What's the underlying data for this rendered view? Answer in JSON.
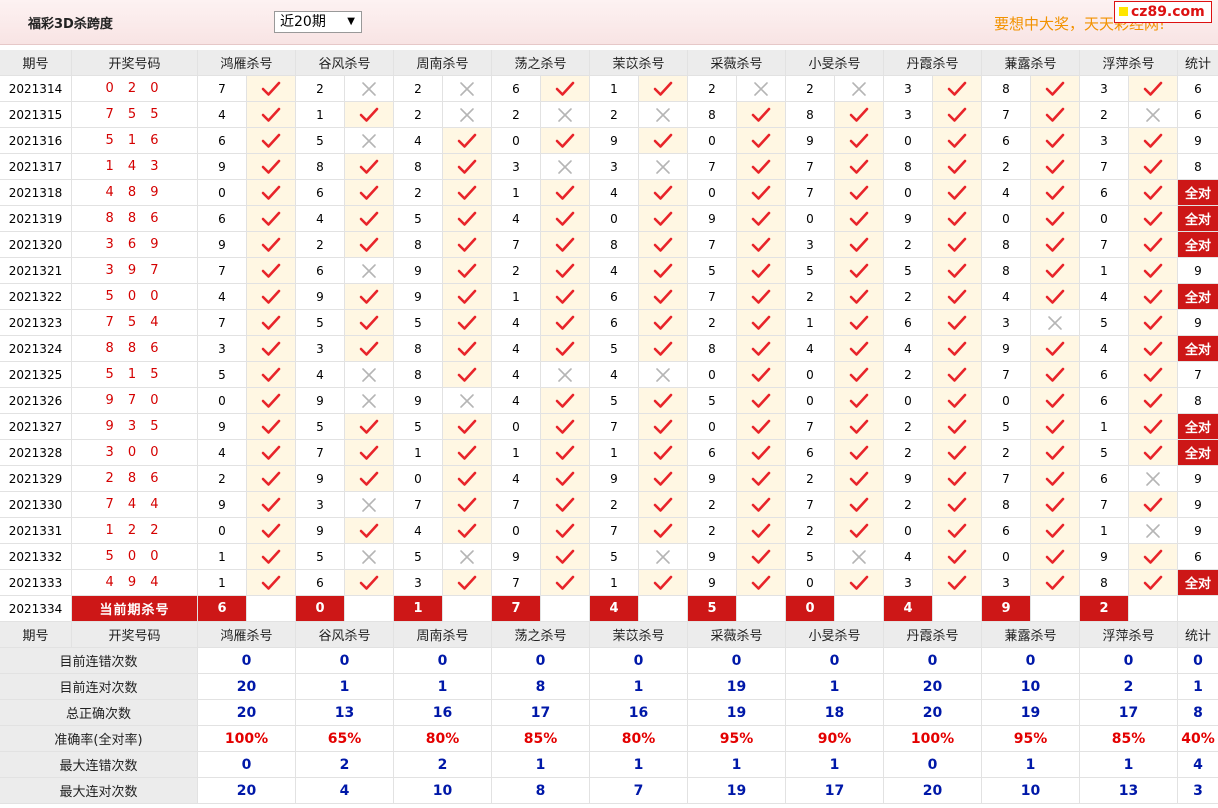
{
  "header": {
    "title": "福彩3D杀跨度",
    "period_option": "近20期",
    "slogan": "要想中大奖，天天彩经网!",
    "site_badge": "cz89.com"
  },
  "columns": {
    "period": "期号",
    "draw": "开奖号码",
    "experts": [
      "鸿雁杀号",
      "谷风杀号",
      "周南杀号",
      "荡之杀号",
      "茉苡杀号",
      "采薇杀号",
      "小旻杀号",
      "丹霞杀号",
      "蒹露杀号",
      "浮萍杀号"
    ],
    "stat": "统计"
  },
  "icons": {
    "correct": "check-icon",
    "wrong": "cross-icon"
  },
  "colors": {
    "check": "#e8242a",
    "cross": "#b5b5b5",
    "badge_red": "#cd1717",
    "stat_blue": "#0018a8",
    "rate_red": "#e30000",
    "slogan_orange": "#f29200"
  },
  "rows": [
    {
      "period": "2021314",
      "draw": "0 2 0",
      "kills": [
        7,
        2,
        2,
        6,
        1,
        2,
        2,
        3,
        8,
        3
      ],
      "ok": [
        1,
        0,
        0,
        1,
        1,
        0,
        0,
        1,
        1,
        1
      ],
      "stat": "6"
    },
    {
      "period": "2021315",
      "draw": "7 5 5",
      "kills": [
        4,
        1,
        2,
        2,
        2,
        8,
        8,
        3,
        7,
        2
      ],
      "ok": [
        1,
        1,
        0,
        0,
        0,
        1,
        1,
        1,
        1,
        0
      ],
      "stat": "6"
    },
    {
      "period": "2021316",
      "draw": "5 1 6",
      "kills": [
        6,
        5,
        4,
        0,
        9,
        0,
        9,
        0,
        6,
        3
      ],
      "ok": [
        1,
        0,
        1,
        1,
        1,
        1,
        1,
        1,
        1,
        1
      ],
      "stat": "9"
    },
    {
      "period": "2021317",
      "draw": "1 4 3",
      "kills": [
        9,
        8,
        8,
        3,
        3,
        7,
        7,
        8,
        2,
        7
      ],
      "ok": [
        1,
        1,
        1,
        0,
        0,
        1,
        1,
        1,
        1,
        1
      ],
      "stat": "8"
    },
    {
      "period": "2021318",
      "draw": "4 8 9",
      "kills": [
        0,
        6,
        2,
        1,
        4,
        0,
        7,
        0,
        4,
        6
      ],
      "ok": [
        1,
        1,
        1,
        1,
        1,
        1,
        1,
        1,
        1,
        1
      ],
      "stat": "全对"
    },
    {
      "period": "2021319",
      "draw": "8 8 6",
      "kills": [
        6,
        4,
        5,
        4,
        0,
        9,
        0,
        9,
        0,
        0
      ],
      "ok": [
        1,
        1,
        1,
        1,
        1,
        1,
        1,
        1,
        1,
        1
      ],
      "stat": "全对"
    },
    {
      "period": "2021320",
      "draw": "3 6 9",
      "kills": [
        9,
        2,
        8,
        7,
        8,
        7,
        3,
        2,
        8,
        7
      ],
      "ok": [
        1,
        1,
        1,
        1,
        1,
        1,
        1,
        1,
        1,
        1
      ],
      "stat": "全对"
    },
    {
      "period": "2021321",
      "draw": "3 9 7",
      "kills": [
        7,
        6,
        9,
        2,
        4,
        5,
        5,
        5,
        8,
        1
      ],
      "ok": [
        1,
        0,
        1,
        1,
        1,
        1,
        1,
        1,
        1,
        1
      ],
      "stat": "9"
    },
    {
      "period": "2021322",
      "draw": "5 0 0",
      "kills": [
        4,
        9,
        9,
        1,
        6,
        7,
        2,
        2,
        4,
        4
      ],
      "ok": [
        1,
        1,
        1,
        1,
        1,
        1,
        1,
        1,
        1,
        1
      ],
      "stat": "全对"
    },
    {
      "period": "2021323",
      "draw": "7 5 4",
      "kills": [
        7,
        5,
        5,
        4,
        6,
        2,
        1,
        6,
        3,
        5
      ],
      "ok": [
        1,
        1,
        1,
        1,
        1,
        1,
        1,
        1,
        0,
        1
      ],
      "stat": "9"
    },
    {
      "period": "2021324",
      "draw": "8 8 6",
      "kills": [
        3,
        3,
        8,
        4,
        5,
        8,
        4,
        4,
        9,
        4
      ],
      "ok": [
        1,
        1,
        1,
        1,
        1,
        1,
        1,
        1,
        1,
        1
      ],
      "stat": "全对"
    },
    {
      "period": "2021325",
      "draw": "5 1 5",
      "kills": [
        5,
        4,
        8,
        4,
        4,
        0,
        0,
        2,
        7,
        6
      ],
      "ok": [
        1,
        0,
        1,
        0,
        0,
        1,
        1,
        1,
        1,
        1
      ],
      "stat": "7"
    },
    {
      "period": "2021326",
      "draw": "9 7 0",
      "kills": [
        0,
        9,
        9,
        4,
        5,
        5,
        0,
        0,
        0,
        6
      ],
      "ok": [
        1,
        0,
        0,
        1,
        1,
        1,
        1,
        1,
        1,
        1
      ],
      "stat": "8"
    },
    {
      "period": "2021327",
      "draw": "9 3 5",
      "kills": [
        9,
        5,
        5,
        0,
        7,
        0,
        7,
        2,
        5,
        1
      ],
      "ok": [
        1,
        1,
        1,
        1,
        1,
        1,
        1,
        1,
        1,
        1
      ],
      "stat": "全对"
    },
    {
      "period": "2021328",
      "draw": "3 0 0",
      "kills": [
        4,
        7,
        1,
        1,
        1,
        6,
        6,
        2,
        2,
        5
      ],
      "ok": [
        1,
        1,
        1,
        1,
        1,
        1,
        1,
        1,
        1,
        1
      ],
      "stat": "全对"
    },
    {
      "period": "2021329",
      "draw": "2 8 6",
      "kills": [
        2,
        9,
        0,
        4,
        9,
        9,
        2,
        9,
        7,
        6
      ],
      "ok": [
        1,
        1,
        1,
        1,
        1,
        1,
        1,
        1,
        1,
        0
      ],
      "stat": "9"
    },
    {
      "period": "2021330",
      "draw": "7 4 4",
      "kills": [
        9,
        3,
        7,
        7,
        2,
        2,
        7,
        2,
        8,
        7
      ],
      "ok": [
        1,
        0,
        1,
        1,
        1,
        1,
        1,
        1,
        1,
        1
      ],
      "stat": "9"
    },
    {
      "period": "2021331",
      "draw": "1 2 2",
      "kills": [
        0,
        9,
        4,
        0,
        7,
        2,
        2,
        0,
        6,
        1
      ],
      "ok": [
        1,
        1,
        1,
        1,
        1,
        1,
        1,
        1,
        1,
        0
      ],
      "stat": "9"
    },
    {
      "period": "2021332",
      "draw": "5 0 0",
      "kills": [
        1,
        5,
        5,
        9,
        5,
        9,
        5,
        4,
        0,
        9
      ],
      "ok": [
        1,
        0,
        0,
        1,
        0,
        1,
        0,
        1,
        1,
        1
      ],
      "stat": "6"
    },
    {
      "period": "2021333",
      "draw": "4 9 4",
      "kills": [
        1,
        6,
        3,
        7,
        1,
        9,
        0,
        3,
        3,
        8
      ],
      "ok": [
        1,
        1,
        1,
        1,
        1,
        1,
        1,
        1,
        1,
        1
      ],
      "stat": "全对"
    }
  ],
  "current": {
    "period": "2021334",
    "label": "当前期杀号",
    "kills": [
      "6",
      "0",
      "1",
      "7",
      "4",
      "5",
      "0",
      "4",
      "9",
      "2"
    ]
  },
  "stats": [
    {
      "label": "目前连错次数",
      "values": [
        "0",
        "0",
        "0",
        "0",
        "0",
        "0",
        "0",
        "0",
        "0",
        "0"
      ],
      "total": "0"
    },
    {
      "label": "目前连对次数",
      "values": [
        "20",
        "1",
        "1",
        "8",
        "1",
        "19",
        "1",
        "20",
        "10",
        "2"
      ],
      "total": "1"
    },
    {
      "label": "总正确次数",
      "values": [
        "20",
        "13",
        "16",
        "17",
        "16",
        "19",
        "18",
        "20",
        "19",
        "17"
      ],
      "total": "8"
    },
    {
      "label": "准确率(全对率)",
      "values": [
        "100%",
        "65%",
        "80%",
        "85%",
        "80%",
        "95%",
        "90%",
        "100%",
        "95%",
        "85%"
      ],
      "total": "40%"
    },
    {
      "label": "最大连错次数",
      "values": [
        "0",
        "2",
        "2",
        "1",
        "1",
        "1",
        "1",
        "0",
        "1",
        "1"
      ],
      "total": "4"
    },
    {
      "label": "最大连对次数",
      "values": [
        "20",
        "4",
        "10",
        "8",
        "7",
        "19",
        "17",
        "20",
        "10",
        "13"
      ],
      "total": "3"
    }
  ]
}
